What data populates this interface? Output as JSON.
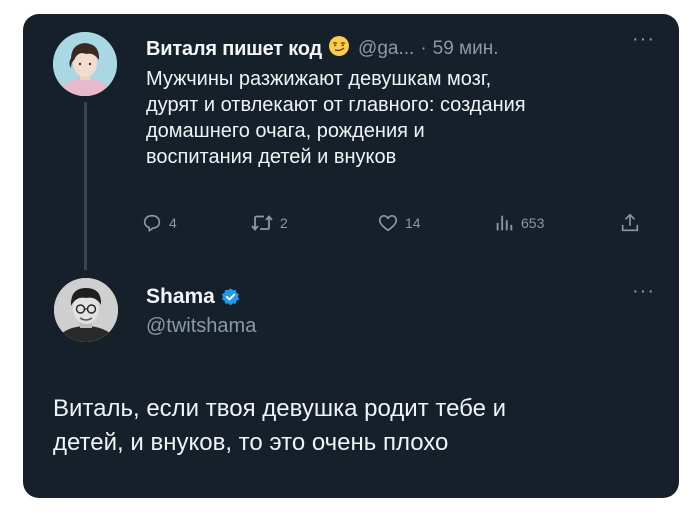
{
  "tweet1": {
    "author_name": "Виталя пишет код",
    "emoji": "😏",
    "handle": "@ga...",
    "separator": "·",
    "time": "59 мин.",
    "more": "···",
    "text_lines": [
      "Мужчины разжижают девушкам мозг,",
      "дурят и отвлекают от главного: создания",
      "домашнего очага, рождения и",
      "воспитания детей и внуков"
    ],
    "actions": {
      "replies": "4",
      "retweets": "2",
      "likes": "14",
      "views": "653"
    }
  },
  "tweet2": {
    "author_name": "Shama",
    "handle": "@twitshama",
    "more": "···",
    "text_lines": [
      "Виталь, если твоя девушка родит тебе и",
      "детей, и внуков, то это очень плохо"
    ]
  },
  "colors": {
    "background": "#15202b",
    "text": "#eff3f4",
    "muted": "#8b98a5",
    "verified": "#1d9bf0"
  }
}
